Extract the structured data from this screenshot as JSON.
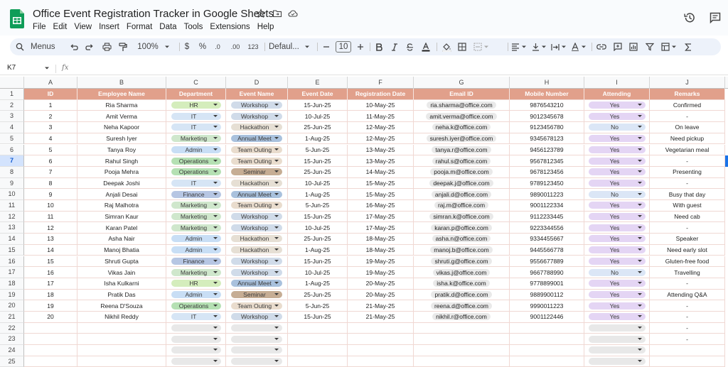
{
  "app": {
    "title": "Office Event Registration Tracker in Google Sheets",
    "menus": [
      "File",
      "Edit",
      "View",
      "Insert",
      "Format",
      "Data",
      "Tools",
      "Extensions",
      "Help"
    ]
  },
  "toolbar": {
    "search_label": "Menus",
    "zoom": "100%",
    "currency": "$",
    "percent": "%",
    "dec_decrease": ".0",
    "dec_increase": ".00",
    "number_format": "123",
    "font": "Defaul...",
    "font_size": "10"
  },
  "formula_bar": {
    "name_box": "K7",
    "fx": "fx"
  },
  "grid": {
    "columns": [
      "A",
      "B",
      "C",
      "D",
      "E",
      "F",
      "G",
      "H",
      "I",
      "J"
    ],
    "row_numbers": [
      "1",
      "2",
      "3",
      "4",
      "5",
      "6",
      "7",
      "8",
      "9",
      "10",
      "11",
      "12",
      "13",
      "14",
      "15",
      "16",
      "17",
      "18",
      "19",
      "20",
      "21",
      "22",
      "23",
      "24",
      "25"
    ],
    "headers": [
      "ID",
      "Employee Name",
      "Department",
      "Event Name",
      "Event Date",
      "Registration Date",
      "Email ID",
      "Mobile Number",
      "Attending",
      "Remarks"
    ],
    "rows": [
      [
        "1",
        "Ria Sharma",
        "HR",
        "Workshop",
        "15-Jun-25",
        "10-May-25",
        "ria.sharma@office.com",
        "9876543210",
        "Yes",
        "Confirmed"
      ],
      [
        "2",
        "Amit Verma",
        "IT",
        "Workshop",
        "10-Jul-25",
        "11-May-25",
        "amit.verma@office.com",
        "9012345678",
        "Yes",
        "-"
      ],
      [
        "3",
        "Neha Kapoor",
        "IT",
        "Hackathon",
        "25-Jun-25",
        "12-May-25",
        "neha.k@office.com",
        "9123456780",
        "No",
        "On leave"
      ],
      [
        "4",
        "Suresh Iyer",
        "Marketing",
        "Annual Meet",
        "1-Aug-25",
        "12-May-25",
        "suresh.iyer@office.com",
        "9345678123",
        "Yes",
        "Need pickup"
      ],
      [
        "5",
        "Tanya Roy",
        "Admin",
        "Team Outing",
        "5-Jun-25",
        "13-May-25",
        "tanya.r@office.com",
        "9456123789",
        "Yes",
        "Vegetarian meal"
      ],
      [
        "6",
        "Rahul Singh",
        "Operations",
        "Team Outing",
        "15-Jun-25",
        "13-May-25",
        "rahul.s@office.com",
        "9567812345",
        "Yes",
        "-"
      ],
      [
        "7",
        "Pooja Mehra",
        "Operations",
        "Seminar",
        "25-Jun-25",
        "14-May-25",
        "pooja.m@office.com",
        "9678123456",
        "Yes",
        "Presenting"
      ],
      [
        "8",
        "Deepak Joshi",
        "IT",
        "Hackathon",
        "10-Jul-25",
        "15-May-25",
        "deepak.j@office.com",
        "9789123450",
        "Yes",
        "-"
      ],
      [
        "9",
        "Anjali Desai",
        "Finance",
        "Annual Meet",
        "1-Aug-25",
        "15-May-25",
        "anjali.d@office.com",
        "9890011223",
        "No",
        "Busy that day"
      ],
      [
        "10",
        "Raj Malhotra",
        "Marketing",
        "Team Outing",
        "5-Jun-25",
        "16-May-25",
        "raj.m@office.com",
        "9001122334",
        "Yes",
        "With guest"
      ],
      [
        "11",
        "Simran Kaur",
        "Marketing",
        "Workshop",
        "15-Jun-25",
        "17-May-25",
        "simran.k@office.com",
        "9112233445",
        "Yes",
        "Need cab"
      ],
      [
        "12",
        "Karan Patel",
        "Marketing",
        "Workshop",
        "10-Jul-25",
        "17-May-25",
        "karan.p@office.com",
        "9223344556",
        "Yes",
        "-"
      ],
      [
        "13",
        "Asha Nair",
        "Admin",
        "Hackathon",
        "25-Jun-25",
        "18-May-25",
        "asha.n@office.com",
        "9334455667",
        "Yes",
        "Speaker"
      ],
      [
        "14",
        "Manoj Bhatia",
        "Admin",
        "Hackathon",
        "1-Aug-25",
        "18-May-25",
        "manoj.b@office.com",
        "9445566778",
        "Yes",
        "Need early slot"
      ],
      [
        "15",
        "Shruti Gupta",
        "Finance",
        "Workshop",
        "15-Jun-25",
        "19-May-25",
        "shruti.g@office.com",
        "9556677889",
        "Yes",
        "Gluten-free food"
      ],
      [
        "16",
        "Vikas Jain",
        "Marketing",
        "Workshop",
        "10-Jul-25",
        "19-May-25",
        "vikas.j@office.com",
        "9667788990",
        "No",
        "Travelling"
      ],
      [
        "17",
        "Isha Kulkarni",
        "HR",
        "Annual Meet",
        "1-Aug-25",
        "20-May-25",
        "isha.k@office.com",
        "9778899001",
        "Yes",
        "-"
      ],
      [
        "18",
        "Pratik Das",
        "Admin",
        "Seminar",
        "25-Jun-25",
        "20-May-25",
        "pratik.d@office.com",
        "9889900112",
        "Yes",
        "Attending Q&A"
      ],
      [
        "19",
        "Reena D'Souza",
        "Operations",
        "Team Outing",
        "5-Jun-25",
        "21-May-25",
        "reena.d@office.com",
        "9990011223",
        "Yes",
        "-"
      ],
      [
        "20",
        "Nikhil Reddy",
        "IT",
        "Workshop",
        "15-Jun-25",
        "21-May-25",
        "nikhil.r@office.com",
        "9001122446",
        "Yes",
        "-"
      ]
    ],
    "empty_row_remarks": [
      "-"
    ]
  },
  "colors": {
    "header_fill": "#e1a08b",
    "dept": {
      "HR": "#d4edbc",
      "IT": "#d6e5f5",
      "Marketing": "#cfe7cc",
      "Admin": "#c8def5",
      "Operations": "#b5e0b3",
      "Finance": "#b6c6e3"
    },
    "event": {
      "Workshop": "#d0dbe9",
      "Hackathon": "#e6dfd4",
      "Annual Meet": "#a9c1dd",
      "Team Outing": "#e9dccd",
      "Seminar": "#c6ad94"
    },
    "attending": {
      "Yes": "#e4d5f4",
      "No": "#dbe6f6"
    }
  }
}
